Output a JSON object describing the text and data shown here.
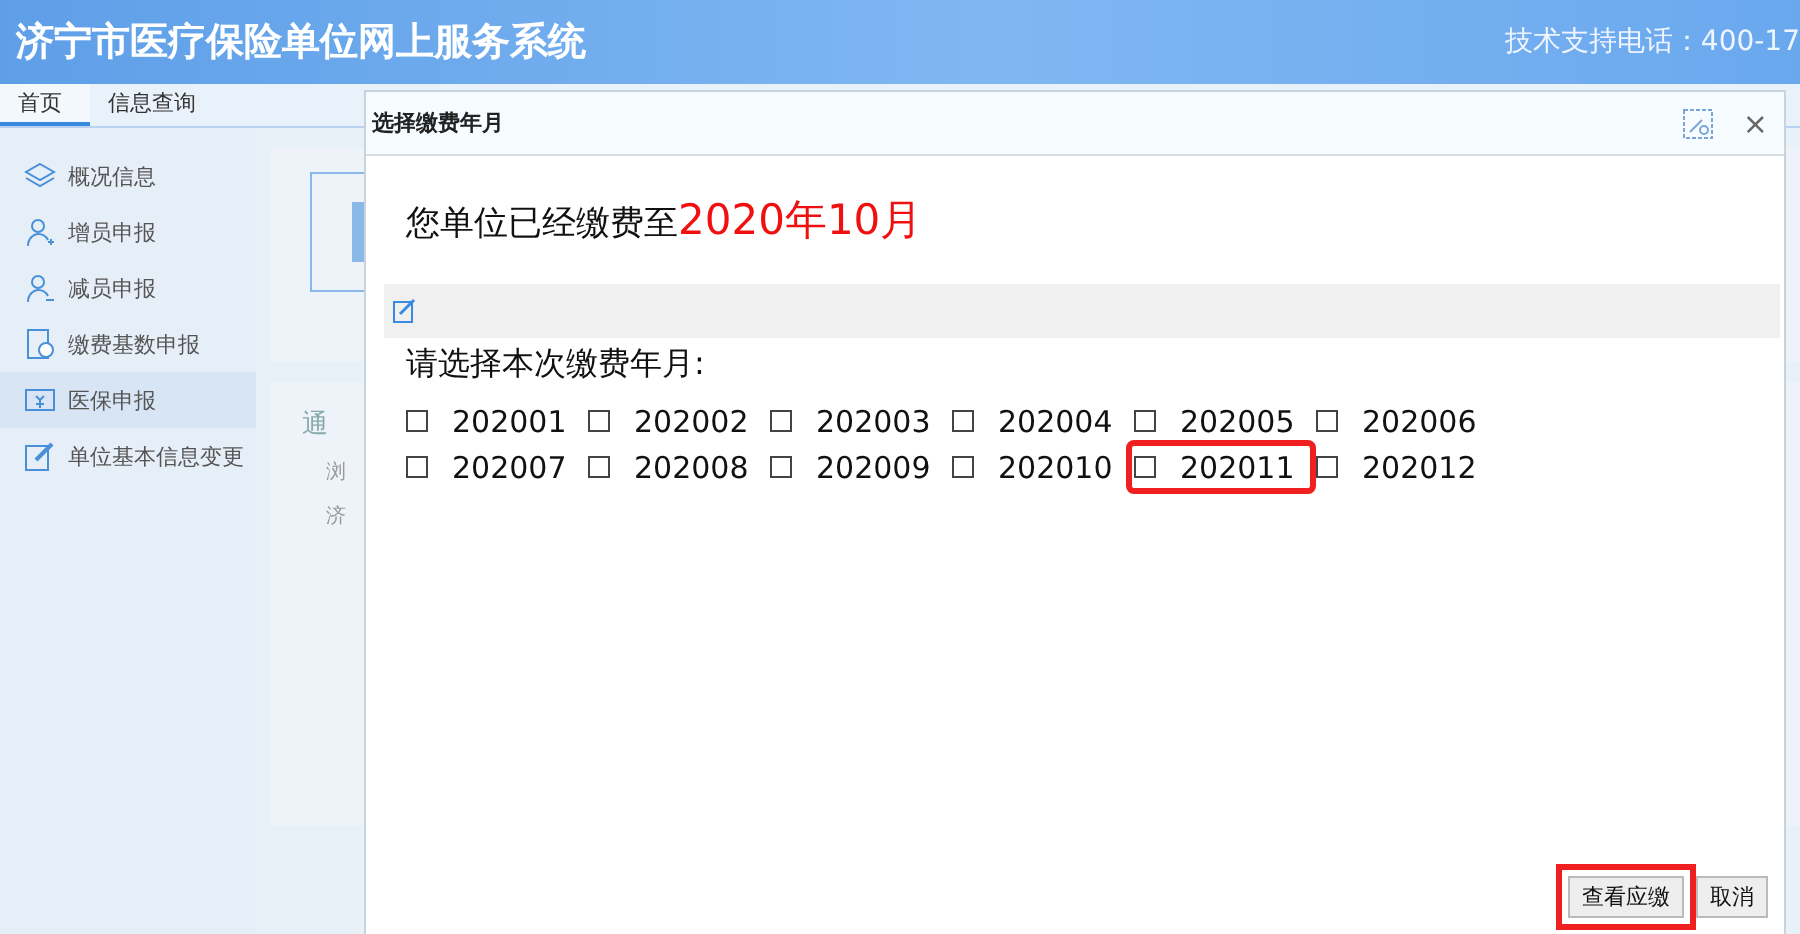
{
  "header": {
    "title": "济宁市医疗保险单位网上服务系统",
    "support": "技术支持电话：400-17"
  },
  "tabs": [
    {
      "label": "首页",
      "selected": true
    },
    {
      "label": "信息查询",
      "selected": false
    }
  ],
  "sidebar": {
    "items": [
      {
        "label": "概况信息",
        "selected": false
      },
      {
        "label": "增员申报",
        "selected": false
      },
      {
        "label": "减员申报",
        "selected": false
      },
      {
        "label": "缴费基数申报",
        "selected": false
      },
      {
        "label": "医保申报",
        "selected": true
      },
      {
        "label": "单位基本信息变更",
        "selected": false
      }
    ]
  },
  "background_panel": {
    "heading": "通",
    "bullets": [
      "浏",
      "济"
    ]
  },
  "dialog": {
    "title": "选择缴费年月",
    "close": "×",
    "paid_label": "您单位已经缴费至",
    "paid_until": "2020年10月",
    "prompt": "请选择本次缴费年月:",
    "months": [
      {
        "label": "202001",
        "checked": false,
        "highlighted": false
      },
      {
        "label": "202002",
        "checked": false,
        "highlighted": false
      },
      {
        "label": "202003",
        "checked": false,
        "highlighted": false
      },
      {
        "label": "202004",
        "checked": false,
        "highlighted": false
      },
      {
        "label": "202005",
        "checked": false,
        "highlighted": false
      },
      {
        "label": "202006",
        "checked": false,
        "highlighted": false
      },
      {
        "label": "202007",
        "checked": false,
        "highlighted": false
      },
      {
        "label": "202008",
        "checked": false,
        "highlighted": false
      },
      {
        "label": "202009",
        "checked": false,
        "highlighted": false
      },
      {
        "label": "202010",
        "checked": false,
        "highlighted": false
      },
      {
        "label": "202011",
        "checked": false,
        "highlighted": true
      },
      {
        "label": "202012",
        "checked": false,
        "highlighted": false
      }
    ],
    "buttons": [
      {
        "label": "查看应缴",
        "highlighted": true
      },
      {
        "label": "取消",
        "highlighted": false
      }
    ]
  }
}
